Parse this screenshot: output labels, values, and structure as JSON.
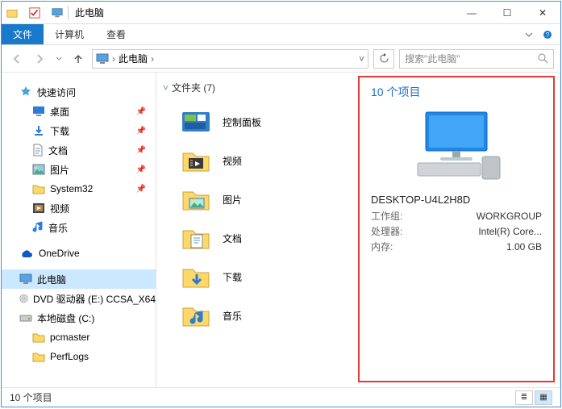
{
  "window": {
    "title": "此电脑"
  },
  "ribbon": {
    "file": "文件",
    "computer": "计算机",
    "view": "查看"
  },
  "address": {
    "crumb1": "此电脑",
    "refresh_tip": "刷新"
  },
  "search": {
    "placeholder": "搜索\"此电脑\""
  },
  "nav": {
    "quick": "快速访问",
    "desktop": "桌面",
    "downloads": "下载",
    "documents": "文档",
    "pictures": "图片",
    "system32": "System32",
    "videos": "视频",
    "music": "音乐",
    "onedrive": "OneDrive",
    "thispc": "此电脑",
    "dvd": "DVD 驱动器 (E:) CCSA_X64",
    "c": "本地磁盘 (C:)",
    "pcmaster": "pcmaster",
    "perflogs": "PerfLogs"
  },
  "content": {
    "folders_header": "文件夹 (7)",
    "cpl": "控制面板",
    "videos": "视频",
    "pictures": "图片",
    "documents": "文档",
    "downloads": "下载",
    "music": "音乐"
  },
  "panel": {
    "title": "10 个项目",
    "computer_name": "DESKTOP-U4L2H8D",
    "workgroup_k": "工作组:",
    "workgroup_v": "WORKGROUP",
    "cpu_k": "处理器:",
    "cpu_v": "Intel(R) Core...",
    "mem_k": "内存:",
    "mem_v": "1.00 GB"
  },
  "status": {
    "text": "10 个项目"
  },
  "colors": {
    "accent": "#1979ca",
    "highlight_border": "#e53935"
  }
}
